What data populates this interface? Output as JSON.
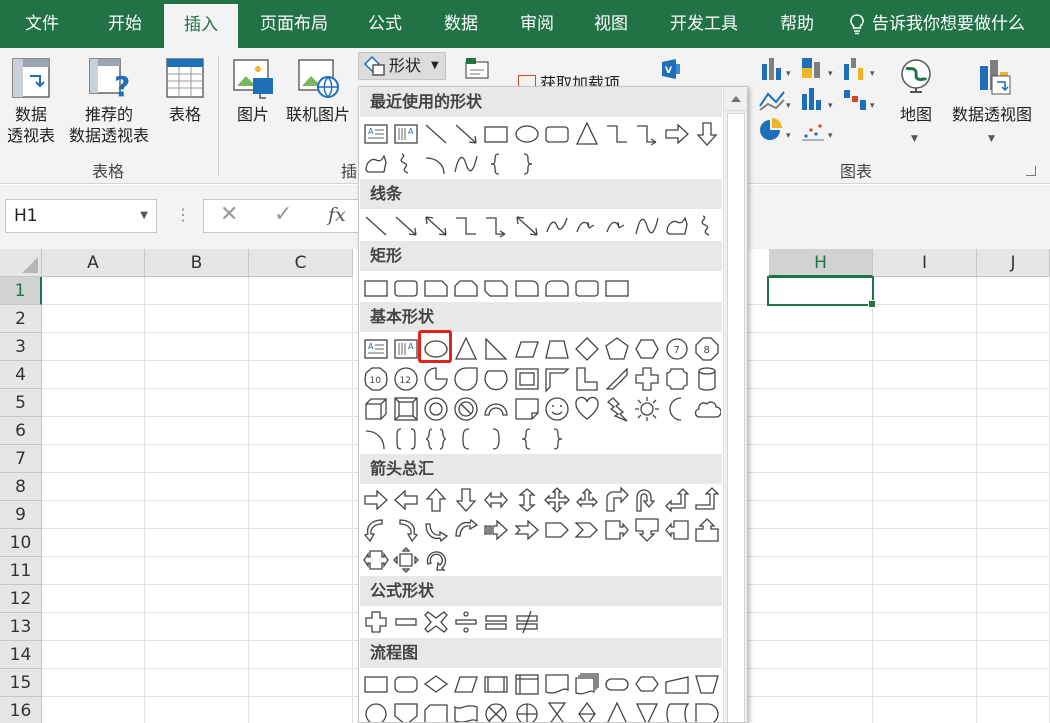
{
  "tabs": {
    "file": "文件",
    "home": "开始",
    "insert": "插入",
    "page_layout": "页面布局",
    "formulas": "公式",
    "data": "数据",
    "review": "审阅",
    "view": "视图",
    "developer": "开发工具",
    "help": "帮助"
  },
  "tell_me": "告诉我你想要做什么",
  "ribbon": {
    "pivot_table_line1": "数据",
    "pivot_table_line2": "透视表",
    "recommended_pivot_line1": "推荐的",
    "recommended_pivot_line2": "数据透视表",
    "table": "表格",
    "tables_group": "表格",
    "picture": "图片",
    "online_picture": "联机图片",
    "illustrations_group_partial": "插",
    "shapes": "形状",
    "get_addins_partial": "获取加载项",
    "map": "地图",
    "pivot_chart": "数据透视图",
    "charts_group": "图表"
  },
  "name_box": "H1",
  "columns": [
    "A",
    "B",
    "C",
    "H",
    "I",
    "J"
  ],
  "selected_column": "H",
  "rows": [
    "1",
    "2",
    "3",
    "4",
    "5",
    "6",
    "7",
    "8",
    "9",
    "10",
    "11",
    "12",
    "13",
    "14",
    "15",
    "16"
  ],
  "selected_row": "1",
  "shapes_menu": {
    "recent": "最近使用的形状",
    "lines": "线条",
    "rectangles": "矩形",
    "basic": "基本形状",
    "arrows": "箭头总汇",
    "equation": "公式形状",
    "flowchart": "流程图",
    "highlighted_shape": "oval-icon"
  },
  "colors": {
    "excel_green": "#217346",
    "highlight_red": "#e0241c"
  }
}
